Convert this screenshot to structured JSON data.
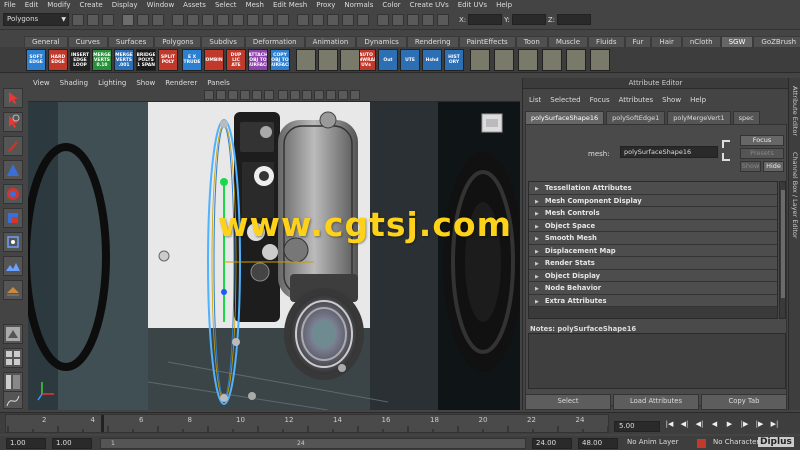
{
  "menubar": [
    "File",
    "Edit",
    "Modify",
    "Create",
    "Display",
    "Window",
    "Assets",
    "Select",
    "Mesh",
    "Edit Mesh",
    "Proxy",
    "Normals",
    "Color",
    "Create UVs",
    "Edit UVs",
    "Help"
  ],
  "status_line": {
    "mode": "Polygons",
    "coords": [
      "X:",
      "Y:",
      "Z:"
    ]
  },
  "shelf_tabs": [
    "General",
    "Curves",
    "Surfaces",
    "Polygons",
    "Subdivs",
    "Deformation",
    "Animation",
    "Dynamics",
    "Rendering",
    "PaintEffects",
    "Toon",
    "Muscle",
    "Fluids",
    "Fur",
    "Hair",
    "nCloth",
    "SGW",
    "GoZBrush"
  ],
  "active_shelf_tab": "SGW",
  "shelf_icons": [
    {
      "label": "SOFT EDGE",
      "color": "#2d7fd0"
    },
    {
      "label": "HARD EDGE",
      "color": "#c0392b"
    },
    {
      "label": "INSERT EDGE LOOP",
      "color": "#222222"
    },
    {
      "label": "MERGE VERTS 0.10",
      "color": "#2a8f3a"
    },
    {
      "label": "MERGE VERTS .001",
      "color": "#2d6fb5"
    },
    {
      "label": "BRIDGE POLYS 1 SPAN",
      "color": "#1a1a1a"
    },
    {
      "label": "SPLIT POLY",
      "color": "#c0392b"
    },
    {
      "label": "E X TRUDE",
      "color": "#2d7fd0"
    },
    {
      "label": "COMBINE",
      "color": "#c0392b"
    },
    {
      "label": "DUP LIC ATE",
      "color": "#c0392b"
    },
    {
      "label": "ATTACH OBJ TO SURFACE",
      "color": "#8e44ad"
    },
    {
      "label": "COPY OBJ TO SURFACE",
      "color": "#2d7fd0"
    },
    {
      "label": "AUTO UNWRAP UVs",
      "color": "#c0392b"
    },
    {
      "label": "Out",
      "color": "#2d6fb5"
    },
    {
      "label": "UTE",
      "color": "#2d6fb5"
    },
    {
      "label": "Hshd",
      "color": "#2d6fb5"
    },
    {
      "label": "HIST ORY",
      "color": "#2d6fb5"
    }
  ],
  "viewport": {
    "menu": [
      "View",
      "Shading",
      "Lighting",
      "Show",
      "Renderer",
      "Panels"
    ],
    "axis_label": "",
    "watermark": "www.cgtsj.com"
  },
  "attribute_editor": {
    "title": "Attribute Editor",
    "menu": [
      "List",
      "Selected",
      "Focus",
      "Attributes",
      "Show",
      "Help"
    ],
    "tabs": [
      "polySurfaceShape16",
      "polySoftEdge1",
      "polyMergeVert1",
      "spec"
    ],
    "active_tab": "polySurfaceShape16",
    "mesh_label": "mesh:",
    "mesh_value": "polySurfaceShape16",
    "focus_label": "Focus",
    "presets_label": "Presets",
    "show_label": "Show",
    "hide_label": "Hide",
    "sections": [
      "Tessellation Attributes",
      "Mesh Component Display",
      "Mesh Controls",
      "Object Space",
      "Smooth Mesh",
      "Displacement Map",
      "Render Stats",
      "Object Display",
      "Node Behavior",
      "Extra Attributes"
    ],
    "notes_label": "Notes:  polySurfaceShape16",
    "buttons": [
      "Select",
      "Load Attributes",
      "Copy Tab"
    ]
  },
  "right_strip": [
    "Attribute Editor",
    "Channel Box / Layer Editor"
  ],
  "timeslider": {
    "ticks": [
      "2",
      "4",
      "6",
      "8",
      "10",
      "12",
      "14",
      "16",
      "18",
      "20",
      "22",
      "24"
    ],
    "current_frame": "5.00"
  },
  "range_bar": {
    "start_time": "1.00",
    "start_range": "1.00",
    "range_start_label": "1",
    "range_end_label": "24",
    "end_range": "24.00",
    "end_time": "48.00",
    "anim_layer": "No Anim Layer",
    "char_set": "No Character Set"
  },
  "logo": "Diplus"
}
